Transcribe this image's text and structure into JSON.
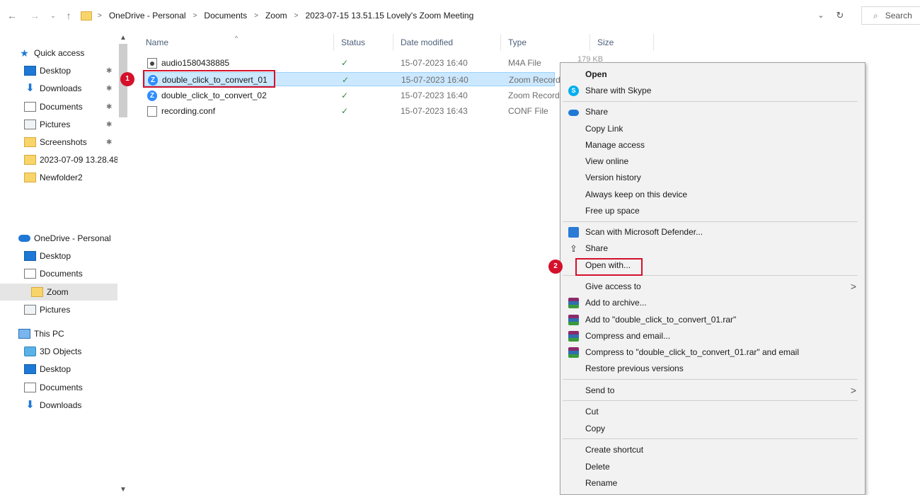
{
  "address": {
    "crumbs": [
      "OneDrive - Personal",
      "Documents",
      "Zoom",
      "2023-07-15 13.51.15 Lovely's Zoom Meeting"
    ],
    "search_placeholder": "Search"
  },
  "sidebar": {
    "quick_access": "Quick access",
    "quick_items": [
      {
        "label": "Desktop",
        "icon": "desktop-icon"
      },
      {
        "label": "Downloads",
        "icon": "downloads-icon"
      },
      {
        "label": "Documents",
        "icon": "documents-icon"
      },
      {
        "label": "Pictures",
        "icon": "pictures-icon"
      },
      {
        "label": "Screenshots",
        "icon": "folder-icon"
      },
      {
        "label": "2023-07-09 13.28.48",
        "icon": "folder-icon"
      },
      {
        "label": "Newfolder2",
        "icon": "folder-icon"
      }
    ],
    "onedrive": "OneDrive - Personal",
    "onedrive_items": [
      "Desktop",
      "Documents",
      "Zoom",
      "Pictures"
    ],
    "this_pc": "This PC",
    "pc_items": [
      "3D Objects",
      "Desktop",
      "Documents",
      "Downloads"
    ]
  },
  "columns": {
    "name": "Name",
    "status": "Status",
    "date": "Date modified",
    "type": "Type",
    "size": "Size"
  },
  "files": [
    {
      "name": "audio1580438885",
      "date": "15-07-2023 16:40",
      "type": "M4A File",
      "size": "179 KB",
      "icon": "audio-file-icon"
    },
    {
      "name": "double_click_to_convert_01",
      "date": "15-07-2023 16:40",
      "type": "Zoom Recording",
      "icon": "zoom-icon",
      "selected": true
    },
    {
      "name": "double_click_to_convert_02",
      "date": "15-07-2023 16:40",
      "type": "Zoom Recording",
      "icon": "zoom-icon"
    },
    {
      "name": "recording.conf",
      "date": "15-07-2023 16:43",
      "type": "CONF File",
      "icon": "file-icon"
    }
  ],
  "callouts": [
    "1",
    "2"
  ],
  "context_menu": {
    "open": "Open",
    "share_skype": "Share with Skype",
    "share_onedrive": "Share",
    "copy_link": "Copy Link",
    "manage_access": "Manage access",
    "view_online": "View online",
    "version_history": "Version history",
    "always_keep": "Always keep on this device",
    "free_up": "Free up space",
    "scan_defender": "Scan with Microsoft Defender...",
    "share": "Share",
    "open_with": "Open with...",
    "give_access": "Give access to",
    "add_archive": "Add to archive...",
    "add_rar": "Add to \"double_click_to_convert_01.rar\"",
    "compress_email": "Compress and email...",
    "compress_rar_email": "Compress to \"double_click_to_convert_01.rar\" and email",
    "restore": "Restore previous versions",
    "send_to": "Send to",
    "cut": "Cut",
    "copy": "Copy",
    "create_shortcut": "Create shortcut",
    "delete": "Delete",
    "rename": "Rename"
  },
  "colors": {
    "selection": "#cce8ff",
    "callout": "#d5102b",
    "accent": "#1e78d6"
  }
}
